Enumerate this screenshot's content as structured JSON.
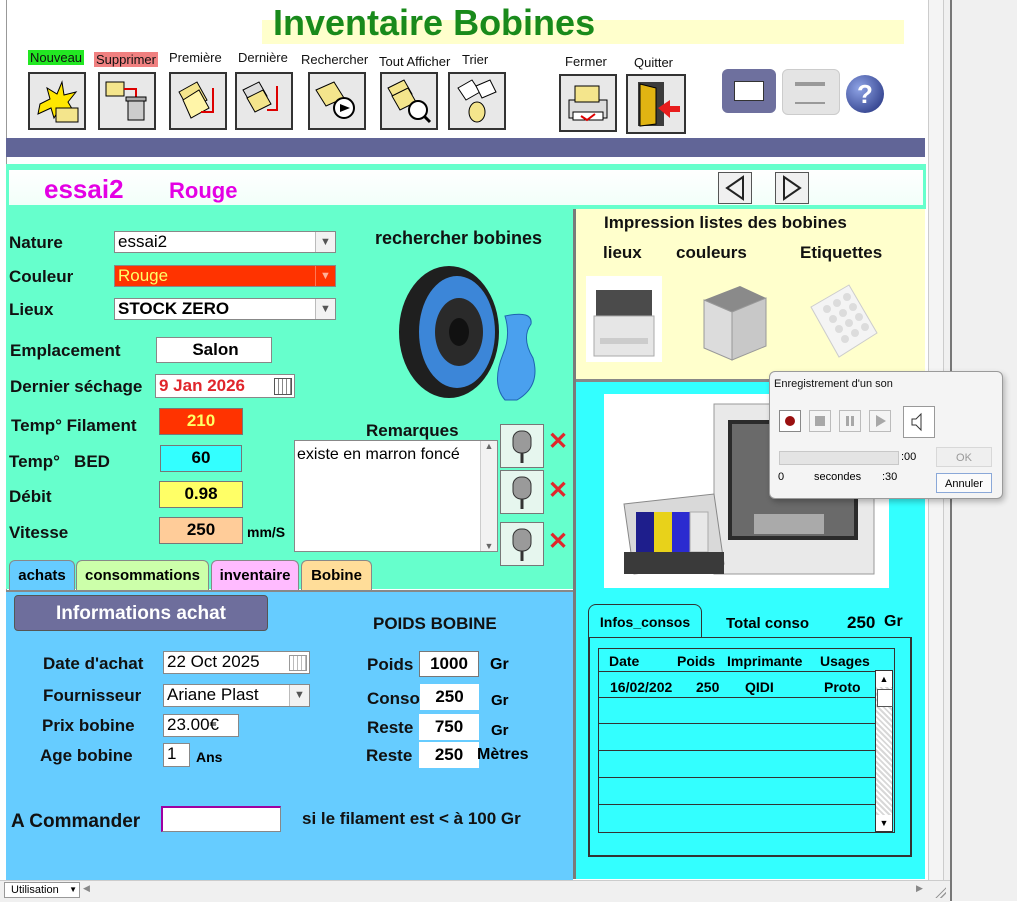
{
  "app": {
    "title": "Inventaire Bobines"
  },
  "toolbar": {
    "nouveau": "Nouveau",
    "supprimer": "Supprimer",
    "premiere": "Première",
    "derniere": "Dernière",
    "rechercher": "Rechercher",
    "tout_afficher": "Tout Afficher",
    "trier": "Trier",
    "fermer": "Fermer",
    "quitter": "Quitter"
  },
  "record": {
    "nature": "essai2",
    "couleur": "Rouge"
  },
  "form": {
    "nature_label": "Nature",
    "nature_value": "essai2",
    "couleur_label": "Couleur",
    "couleur_value": "Rouge",
    "lieux_label": "Lieux",
    "lieux_value": "STOCK ZERO",
    "emplacement_label": "Emplacement",
    "emplacement_value": "Salon",
    "dernier_sechage_label": "Dernier séchage",
    "dernier_sechage_value": "9 Jan 2026",
    "temp_filament_label": "Temp° Filament",
    "temp_filament_value": "210",
    "temp_bed_label": "Temp°   BED",
    "temp_bed_value": "60",
    "debit_label": "Débit",
    "debit_value": "0.98",
    "vitesse_label": "Vitesse",
    "vitesse_value": "250",
    "vitesse_unit": "mm/S",
    "rechercher_bobines": "rechercher bobines",
    "remarques_label": "Remarques",
    "remarques_value": "existe en marron foncé"
  },
  "impression": {
    "title": "Impression listes des bobines",
    "lieux": "lieux",
    "couleurs": "couleurs",
    "etiquettes": "Etiquettes"
  },
  "tabs": [
    "achats",
    "consommations",
    "inventaire",
    "Bobine"
  ],
  "achat": {
    "section_title": "Informations achat",
    "date_label": "Date d'achat",
    "date_value": "22 Oct 2025",
    "fournisseur_label": "Fournisseur",
    "fournisseur_value": "Ariane Plast",
    "prix_label": "Prix bobine",
    "prix_value": "23.00€",
    "age_label": "Age bobine",
    "age_value": "1",
    "age_unit": "Ans",
    "a_commander_label": "A Commander",
    "a_commander_value": "",
    "commander_note": "si le filament est < à 100 Gr"
  },
  "poids": {
    "title": "POIDS BOBINE",
    "poids_label": "Poids",
    "poids_value": "1000",
    "poids_unit": "Gr",
    "conso_label": "Conso",
    "conso_value": "250",
    "conso_unit": "Gr",
    "reste_label": "Reste",
    "reste_value": "750",
    "reste_unit": "Gr",
    "reste_m_label": "Reste",
    "reste_m_value": "250",
    "reste_m_unit": "Mètres"
  },
  "consos": {
    "tab_label": "Infos_consos",
    "total_label": "Total conso",
    "total_value": "250",
    "total_unit": "Gr",
    "columns": [
      "Date",
      "Poids",
      "Imprimante",
      "Usages"
    ],
    "rows": [
      [
        "16/02/202",
        "250",
        "QIDI",
        "Proto"
      ]
    ]
  },
  "sound_dialog": {
    "title": "Enregistrement d'un son",
    "position": ":00",
    "scale_start": "0",
    "scale_unit": "secondes",
    "scale_end": ":30",
    "ok": "OK",
    "annuler": "Annuler"
  },
  "status": {
    "view_mode": "Utilisation"
  },
  "colors": {
    "title_green": "#198a1b",
    "form_green": "#66ffcc",
    "tab_blue": "#66ccff",
    "cyan_panel": "#33ffff",
    "yellow_panel": "#ffffcc",
    "record_magenta": "#e400e4",
    "couleur_red": "#ff3300"
  }
}
